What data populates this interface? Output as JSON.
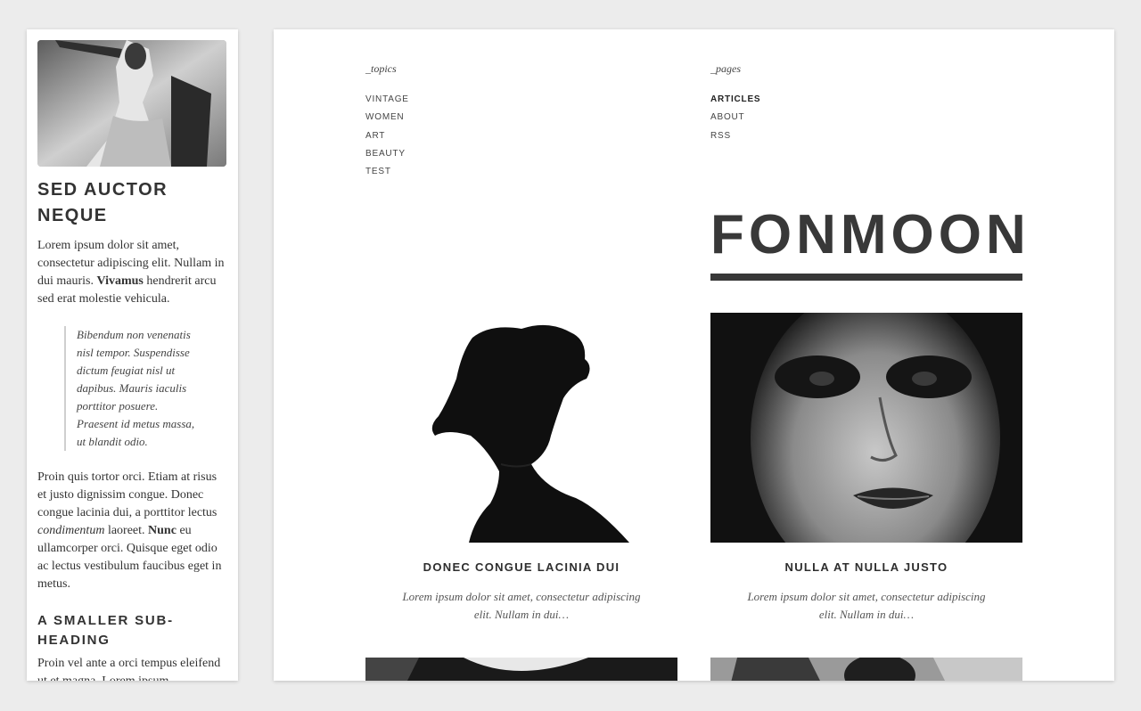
{
  "sidebar_article": {
    "title": "SED AUCTOR NEQUE",
    "intro_part1": "Lorem ipsum dolor sit amet, consectetur adipiscing elit. Nullam in dui mauris. ",
    "intro_bold": "Vivamus",
    "intro_part2": " hendrerit arcu sed erat molestie vehicula.",
    "quote": "Bibendum non venenatis nisl tempor. Suspendisse dictum feugiat nisl ut dapibus. Mauris iaculis porttitor posuere. Praesent id metus massa, ut blandit odio.",
    "para2_part1": "Proin quis tortor orci. Etiam at risus et justo dignissim congue. Donec congue lacinia dui, a porttitor lectus ",
    "para2_italic": "condimentum",
    "para2_part2": " laoreet. ",
    "para2_bold": "Nunc",
    "para2_part3": " eu ullamcorper orci. Quisque eget odio ac lectus vestibulum faucibus eget in metus.",
    "subheading": "A SMALLER SUB-HEADING",
    "tail": "Proin vel ante a orci tempus eleifend ut et magna. Lorem ipsum"
  },
  "nav": {
    "topics_heading": "_topics",
    "topics": [
      "VINTAGE",
      "WOMEN",
      "ART",
      "BEAUTY",
      "TEST"
    ],
    "pages_heading": "_pages",
    "pages": [
      "ARTICLES",
      "ABOUT",
      "RSS"
    ]
  },
  "brand": "FONMOON",
  "posts": [
    {
      "title": "DONEC CONGUE LACINIA DUI",
      "excerpt": "Lorem ipsum dolor sit amet, consectetur adipiscing elit. Nullam in dui…"
    },
    {
      "title": "NULLA AT NULLA JUSTO",
      "excerpt": "Lorem ipsum dolor sit amet, consectetur adipiscing elit. Nullam in dui…"
    }
  ]
}
